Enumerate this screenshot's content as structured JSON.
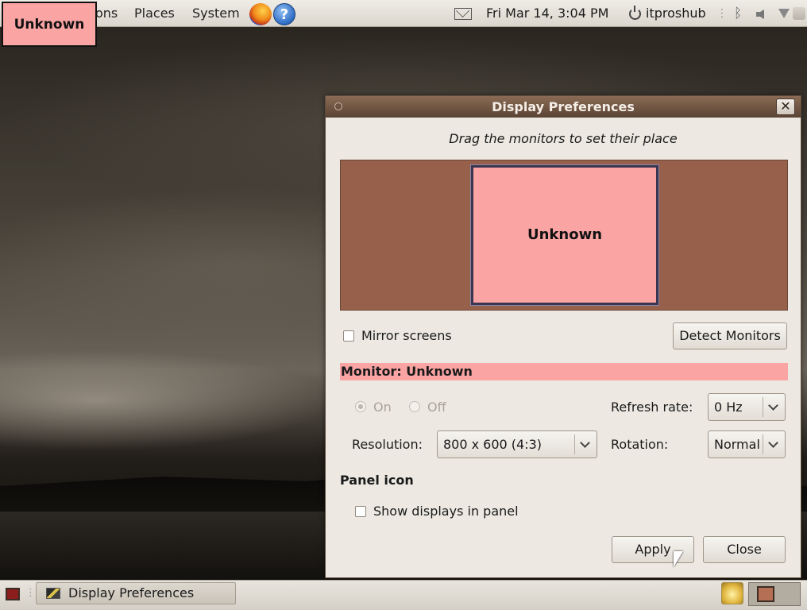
{
  "top_panel": {
    "menus": {
      "applications": "ons",
      "places": "Places",
      "system": "System"
    },
    "clock": "Fri Mar 14,  3:04 PM",
    "username": "itproshub",
    "separator": "⋮",
    "bluetooth_glyph": "ᛒ"
  },
  "overlay_label": "Unknown",
  "dialog": {
    "title": "Display Preferences",
    "close_glyph": "✕",
    "instruction": "Drag the monitors to set their place",
    "monitor_name": "Unknown",
    "mirror_screens_label": "Mirror screens",
    "mirror_screens_checked": false,
    "detect_monitors_label": "Detect Monitors",
    "monitor_section_title": "Monitor: Unknown",
    "on_label": "On",
    "off_label": "Off",
    "refresh_rate_label": "Refresh rate:",
    "refresh_rate_value": "0 Hz",
    "resolution_label": "Resolution:",
    "resolution_value": "800 x 600 (4:3)",
    "rotation_label": "Rotation:",
    "rotation_value": "Normal",
    "panel_icon_heading": "Panel icon",
    "show_displays_label": "Show displays in panel",
    "show_displays_checked": false,
    "apply_label": "Apply",
    "close_label": "Close"
  },
  "bottom_panel": {
    "taskbar_item": "Display Preferences",
    "separator": "⋮"
  },
  "colors": {
    "highlight_pink": "#fba4a4",
    "monitor_canvas": "#97604b",
    "titlebar": "#5a4334"
  }
}
